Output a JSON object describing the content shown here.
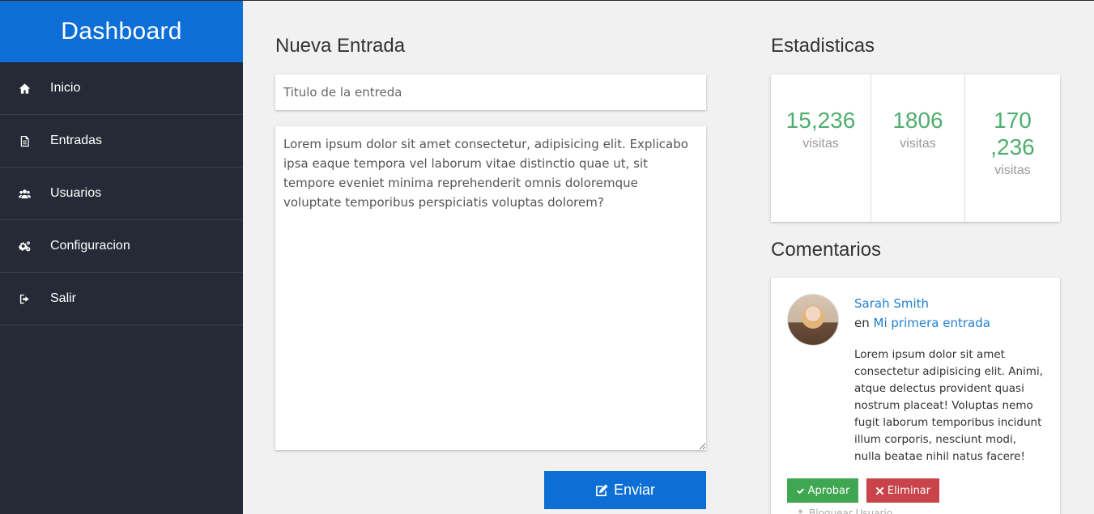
{
  "sidebar": {
    "brand": "Dashboard",
    "items": [
      {
        "label": "Inicio",
        "icon": "home-icon"
      },
      {
        "label": "Entradas",
        "icon": "document-icon"
      },
      {
        "label": "Usuarios",
        "icon": "users-icon"
      },
      {
        "label": "Configuracion",
        "icon": "gears-icon"
      },
      {
        "label": "Salir",
        "icon": "sign-out-icon"
      }
    ]
  },
  "new_entry": {
    "title": "Nueva Entrada",
    "title_placeholder": "Titulo de la entreda",
    "body": "Lorem ipsum dolor sit amet consectetur, adipisicing elit. Explicabo ipsa eaque tempora vel laborum vitae distinctio quae ut, sit tempore eveniet minima reprehenderit omnis doloremque voluptate temporibus perspiciatis voluptas dolorem?",
    "send_label": "Enviar"
  },
  "stats": {
    "title": "Estadisticas",
    "items": [
      {
        "value": "15,236",
        "unit": "visitas"
      },
      {
        "value": "1806",
        "unit": "visitas"
      },
      {
        "value": "170\n,236",
        "unit": "visitas"
      }
    ]
  },
  "comments": {
    "title": "Comentarios",
    "items": [
      {
        "author": "Sarah Smith",
        "prefix": "en",
        "post": "Mi primera entrada",
        "text": "Lorem ipsum dolor sit amet consectetur adipisicing elit. Animi, atque delectus provident quasi nostrum placeat! Voluptas nemo fugit laborum temporibus incidunt illum corporis, nesciunt modi, nulla beatae nihil natus facere!",
        "approve_label": "Aprobar",
        "delete_label": "Eliminar",
        "block_label": "Bloquear Usuario"
      }
    ]
  },
  "colors": {
    "brand": "#0d6fd6",
    "sidebar": "#252a36",
    "stat_number": "#4fae6f",
    "approve": "#3fa652",
    "delete": "#c9444a",
    "link": "#1f7fd1"
  }
}
